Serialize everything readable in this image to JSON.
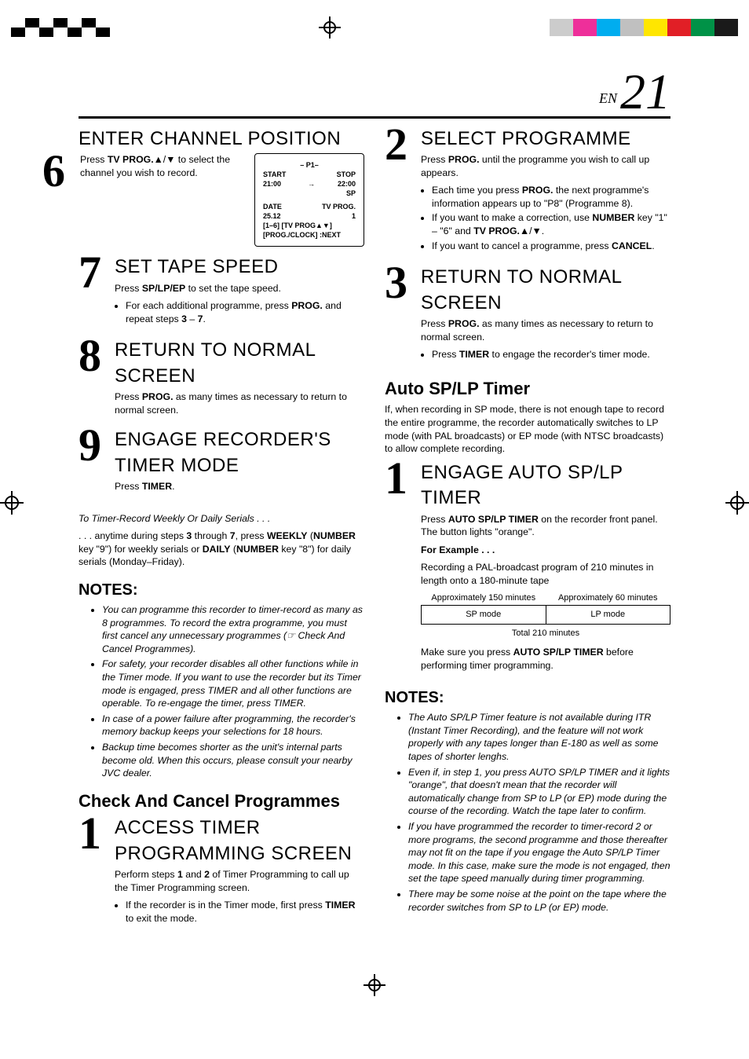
{
  "header": {
    "en_label": "EN",
    "page_number": "21"
  },
  "lcd": {
    "p_line": "– P1–",
    "start_label": "START",
    "start_value": "21:00",
    "arrow": "→",
    "stop_label": "STOP",
    "stop_value": "22:00",
    "speed": "SP",
    "date_label": "DATE",
    "date_value": "25.12",
    "tvprog_label": "TV PROG.",
    "tvprog_value": "1",
    "hint1": "[1–6] [TV PROG▲▼]",
    "hint2": "[PROG./CLOCK] :NEXT"
  },
  "left": {
    "step6": {
      "num": "6",
      "title": "ENTER CHANNEL POSITION",
      "text_parts": [
        "Press ",
        "TV PROG.",
        "▲/▼ to select the channel you wish to record."
      ]
    },
    "step7": {
      "num": "7",
      "title": "SET TAPE SPEED",
      "line_parts": [
        "Press ",
        "SP/LP/EP",
        " to set the tape speed."
      ],
      "bullet_parts": [
        "For each additional programme, press ",
        "PROG.",
        " and repeat steps ",
        "3",
        " – ",
        "7",
        "."
      ]
    },
    "step8": {
      "num": "8",
      "title": "RETURN TO NORMAL SCREEN",
      "line_parts": [
        "Press ",
        "PROG.",
        " as many times as necessary to return to normal screen."
      ]
    },
    "step9": {
      "num": "9",
      "title": "ENGAGE RECORDER'S TIMER MODE",
      "line_parts": [
        "Press ",
        "TIMER",
        "."
      ]
    },
    "serials_intro": "To Timer-Record Weekly Or Daily Serials . . .",
    "serials_body_parts": [
      ". . . anytime during steps ",
      "3",
      " through ",
      "7",
      ", press ",
      "WEEKLY",
      " (",
      "NUMBER",
      " key \"9\") for weekly serials or ",
      "DAILY",
      " (",
      "NUMBER",
      " key \"8\") for daily serials (Monday–Friday)."
    ],
    "notes_label": "NOTES:",
    "notes": [
      "You can programme this recorder to timer-record as many as 8 programmes. To record the extra programme, you must first cancel any unnecessary programmes (☞ Check And Cancel Programmes).",
      "For safety, your recorder disables all other functions while in the Timer mode. If you want to use the recorder but its Timer mode is engaged, press TIMER and all other functions are operable. To re-engage the timer, press TIMER.",
      "In case of a power failure after programming, the recorder's memory backup keeps your selections for 18 hours.",
      "Backup time becomes shorter as the unit's internal parts become old. When this occurs, please consult your nearby JVC dealer."
    ],
    "check_cancel_title": "Check And Cancel Programmes",
    "step1b": {
      "num": "1",
      "title": "ACCESS TIMER PROGRAM­MING SCREEN",
      "line_parts": [
        "Perform steps ",
        "1",
        " and ",
        "2",
        " of Timer Programming to call up the Timer Programming screen."
      ],
      "bullet_parts": [
        "If the recorder is in the Timer mode, first press ",
        "TIMER",
        " to exit the mode."
      ]
    }
  },
  "right": {
    "step2": {
      "num": "2",
      "title": "SELECT PROGRAMME",
      "line_parts": [
        "Press ",
        "PROG.",
        " until the programme you wish to call up appears."
      ],
      "bullets": [
        [
          "Each time you press ",
          "PROG.",
          " the next programme's information appears up to \"P8\" (Programme 8)."
        ],
        [
          "If you want to make a correction, use ",
          "NUMBER",
          " key \"1\" – \"6\" and ",
          "TV PROG.",
          "▲/▼."
        ],
        [
          "If you want to cancel a programme, press ",
          "CANCEL",
          "."
        ]
      ]
    },
    "step3": {
      "num": "3",
      "title": "RETURN TO NORMAL SCREEN",
      "line_parts": [
        "Press ",
        "PROG.",
        " as many times as necessary to return to normal screen."
      ],
      "bullet_parts": [
        "Press ",
        "TIMER",
        " to engage the recorder's timer mode."
      ]
    },
    "auto_title": "Auto SP/LP Timer",
    "auto_para": "If, when recording in SP mode, there is not enough tape to record the entire programme, the recorder automatically switches to LP mode (with PAL broadcasts) or EP mode (with NTSC broadcasts) to allow complete recording.",
    "step1c": {
      "num": "1",
      "title": "ENGAGE AUTO SP/LP TIMER",
      "line_parts": [
        "Press ",
        "AUTO SP/LP TIMER",
        " on the recorder front panel. The button lights \"orange\"."
      ],
      "example_label": "For Example . . .",
      "example_body": "Recording a PAL-broadcast program of 210 minutes in length onto a 180-minute tape",
      "table": {
        "h_left": "Approximately 150 minutes",
        "h_right": "Approximately 60 minutes",
        "c_left": "SP mode",
        "c_right": "LP mode",
        "caption": "Total 210 minutes"
      },
      "tail_parts": [
        "Make sure you press ",
        "AUTO SP/LP TIMER",
        " before performing timer programming."
      ]
    },
    "notes_label": "NOTES:",
    "notes": [
      "The Auto SP/LP Timer feature is not available during ITR (Instant Timer Recording), and the feature will not work properly with any tapes longer than E-180 as well as some tapes of shorter lenghs.",
      "Even if, in step 1, you press AUTO SP/LP TIMER and it lights \"orange\", that doesn't mean that the recorder will automatically change from SP to LP (or EP) mode during the course of the recording. Watch the tape later to confirm.",
      "If you have programmed the recorder to timer-record 2 or more programs, the second programme and those thereafter may not fit on the tape if you engage the Auto SP/LP Timer mode. In this case, make sure the mode is not engaged, then set the tape speed manually during timer programming.",
      "There may be some noise at the point on the tape where the recorder switches from SP to LP (or EP) mode."
    ]
  },
  "color_swatches": [
    "#cccccc",
    "#ee2f9a",
    "#00adef",
    "#c0c0c0",
    "#ffe600",
    "#e11f26",
    "#009247",
    "#1a1a1a"
  ]
}
